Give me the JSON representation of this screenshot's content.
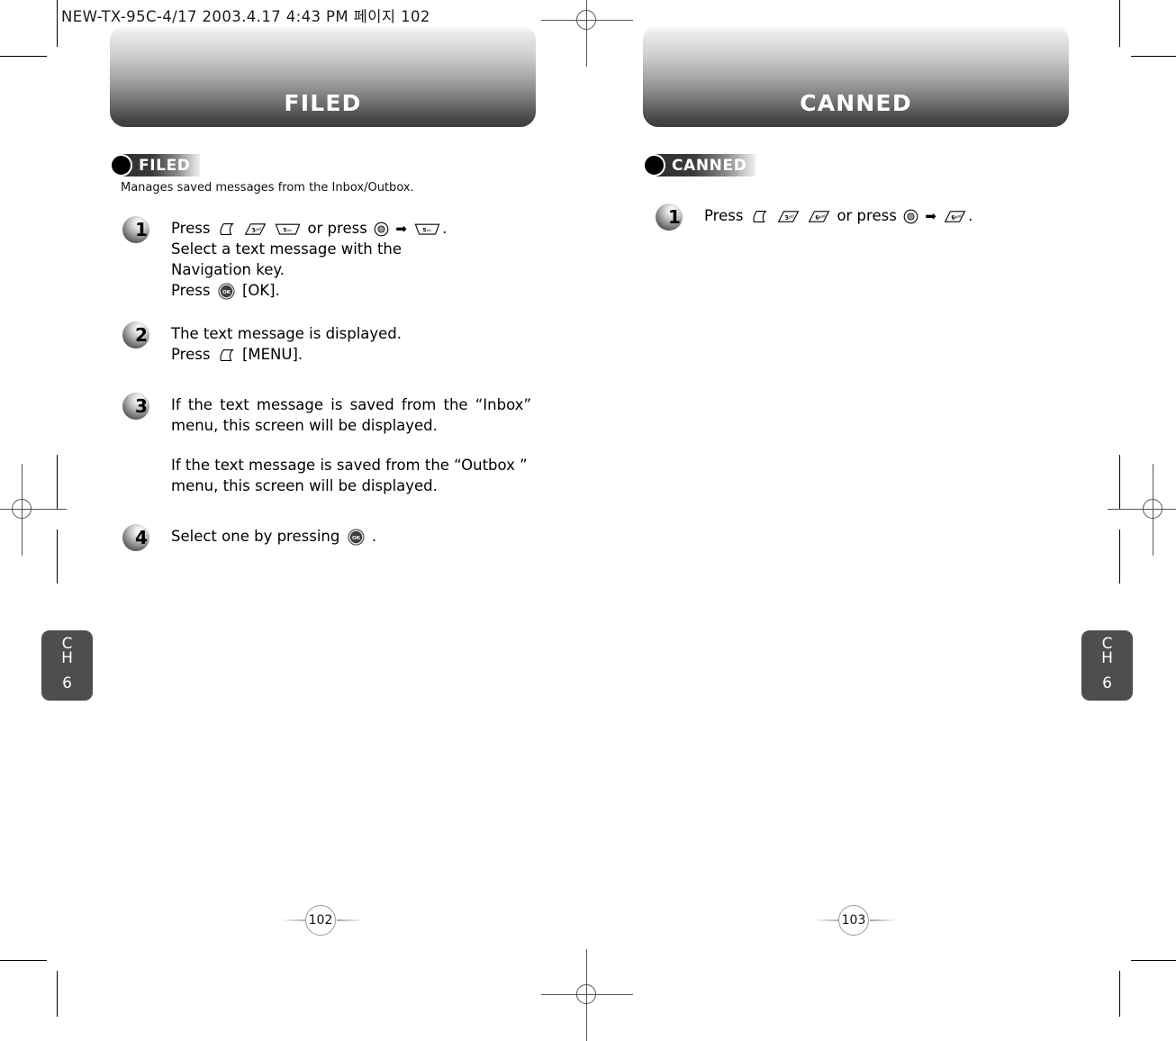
{
  "running_head": "NEW-TX-95C-4/17  2003.4.17 4:43 PM  페이지 102",
  "left_page": {
    "banner_title": "FILED",
    "badge_label": "FILED",
    "description": "Manages saved messages from the Inbox/Outbox.",
    "chapter_tab": {
      "ch_line1": "C",
      "ch_line2": "H",
      "number": "6"
    },
    "folio": "102",
    "steps": [
      {
        "number": "1",
        "lines": [
          "Press [soft] [3def] [5jkl] or press [menu] ➡ [5jkl] .",
          "Select a text message with the",
          "Navigation key.",
          "Press [ok] [OK]."
        ],
        "text_press": "Press",
        "text_or_press": "or press",
        "text_line2": "Select a text message with the",
        "text_line3": "Navigation key.",
        "text_line4_pre": "Press",
        "text_line4_post": "[OK].",
        "period": ".",
        "keys": [
          "soft-key",
          "key-3-def",
          "key-5-jkl",
          "menu-key",
          "key-5-jkl",
          "ok-key"
        ]
      },
      {
        "number": "2",
        "text_line1": "The text message is displayed.",
        "text_line2_pre": "Press",
        "text_line2_post": "[MENU].",
        "keys": [
          "soft-key"
        ]
      },
      {
        "number": "3",
        "para1": "If the text message is saved from the “Inbox”",
        "para1b": "menu, this screen will be displayed.",
        "para2": "If the text message is saved from the “Outbox ”",
        "para2b": "menu, this screen will be displayed."
      },
      {
        "number": "4",
        "text_pre": "Select one by pressing",
        "text_post": ".",
        "keys": [
          "ok-key"
        ]
      }
    ]
  },
  "right_page": {
    "banner_title": "CANNED",
    "badge_label": "CANNED",
    "chapter_tab": {
      "ch_line1": "C",
      "ch_line2": "H",
      "number": "6"
    },
    "folio": "103",
    "steps": [
      {
        "number": "1",
        "text_press": "Press",
        "text_or_press": "or press",
        "period": ".",
        "keys": [
          "soft-key",
          "key-3-def",
          "key-6-mno",
          "menu-key",
          "key-6-mno"
        ]
      }
    ]
  },
  "key_glyphs": {
    "key_3_digit": "3",
    "key_3_letters": "DEF",
    "key_5_digit": "5",
    "key_5_letters": "JKL",
    "key_6_digit": "6",
    "key_6_letters": "MNO",
    "ok_label": "OK",
    "arrow": "➡"
  }
}
